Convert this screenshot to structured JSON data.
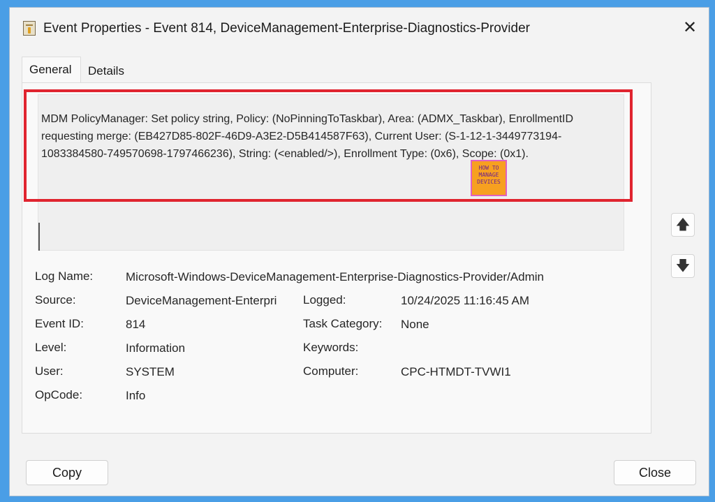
{
  "window": {
    "title": "Event Properties - Event 814, DeviceManagement-Enterprise-Diagnostics-Provider",
    "close_symbol": "✕"
  },
  "tabs": [
    {
      "label": "General",
      "active": true
    },
    {
      "label": "Details",
      "active": false
    }
  ],
  "description": {
    "text": "MDM PolicyManager: Set policy string, Policy: (NoPinningToTaskbar), Area: (ADMX_Taskbar), EnrollmentID requesting merge: (EB427D85-802F-46D9-A3E2-D5B414587F63), Current User: (S-1-12-1-3449773194-1083384580-749570698-1797466236), String: (<enabled/>), Enrollment Type: (0x6), Scope: (0x1).",
    "highlight_color": "#e0242f",
    "watermark_text": "HOW TO MANAGE DEVICES"
  },
  "details": {
    "log_name_label": "Log Name:",
    "log_name_value": "Microsoft-Windows-DeviceManagement-Enterprise-Diagnostics-Provider/Admin",
    "source_label": "Source:",
    "source_value": "DeviceManagement-Enterpri",
    "logged_label": "Logged:",
    "logged_value": "10/24/2025 11:16:45 AM",
    "event_id_label": "Event ID:",
    "event_id_value": "814",
    "task_category_label": "Task Category:",
    "task_category_value": "None",
    "level_label": "Level:",
    "level_value": "Information",
    "keywords_label": "Keywords:",
    "keywords_value": "",
    "user_label": "User:",
    "user_value": "SYSTEM",
    "computer_label": "Computer:",
    "computer_value": "CPC-HTMDT-TVWI1",
    "opcode_label": "OpCode:",
    "opcode_value": "Info"
  },
  "nav": {
    "up_icon": "arrow-up-icon",
    "down_icon": "arrow-down-icon"
  },
  "buttons": {
    "copy_label": "Copy",
    "close_label": "Close"
  },
  "colors": {
    "background": "#4a9ee6",
    "accent_red": "#e0242f"
  }
}
